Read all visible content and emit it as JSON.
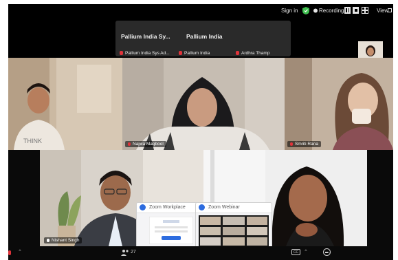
{
  "topbar": {
    "sign_in": "Sign in",
    "recording": "Recording...",
    "view": "View",
    "shield_icon": "shield-check-icon",
    "record_icon": "recording-dot-icon",
    "pause_icon": "pause-icon",
    "stop_icon": "stop-icon",
    "grid_icon": "grid-icon"
  },
  "strip": {
    "participants": [
      {
        "name": "Pallium India Sy...",
        "label": "Pallium India Sys Ad..."
      },
      {
        "name": "Pallium India",
        "label": "Pallium India"
      },
      {
        "label": "Ardhra Thamp"
      }
    ]
  },
  "tiles": [
    {
      "name": ""
    },
    {
      "name": "Najwa Maqbool"
    },
    {
      "name": "Smriti Rana"
    },
    {
      "name": "Nishant Singh"
    },
    {
      "name": ""
    }
  ],
  "popups": [
    {
      "title": "Zoom Workplace"
    },
    {
      "title": "Zoom Webinar"
    }
  ],
  "bottombar": {
    "participants_count": "27",
    "participants_icon": "participants-icon",
    "cc_icon": "closed-caption-icon",
    "more_icon": "more-icon",
    "mic_icon": "mic-muted-icon"
  },
  "colors": {
    "active_speaker": "#34c759",
    "muted": "#e0333a",
    "zoom_blue": "#2d6cdf"
  }
}
